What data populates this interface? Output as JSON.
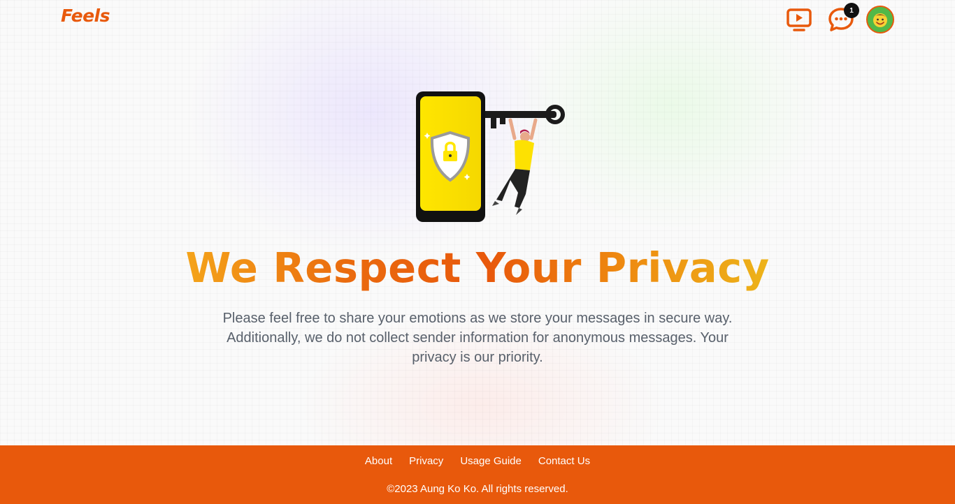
{
  "header": {
    "brand": "Feels",
    "notification_count": "1",
    "icons": {
      "video": "play-screen-icon",
      "chat": "chat-bubble-icon",
      "avatar": "emoji-avatar"
    }
  },
  "hero": {
    "headline": "We Respect Your Privacy",
    "lead": "Please feel free to share your emotions as we store your messages in secure way. Additionally, we do not collect sender information for anonymous messages. Your privacy is our priority.",
    "illustration": "phone-lock-key-illustration"
  },
  "footer": {
    "links": [
      "About",
      "Privacy",
      "Usage Guide",
      "Contact Us"
    ],
    "copyright": "©2023 Aung Ko Ko. All rights reserved."
  },
  "colors": {
    "brand": "#e8590c",
    "text_muted": "#58606b",
    "phone_screen": "#fde102",
    "figure_shirt": "#fde102"
  }
}
